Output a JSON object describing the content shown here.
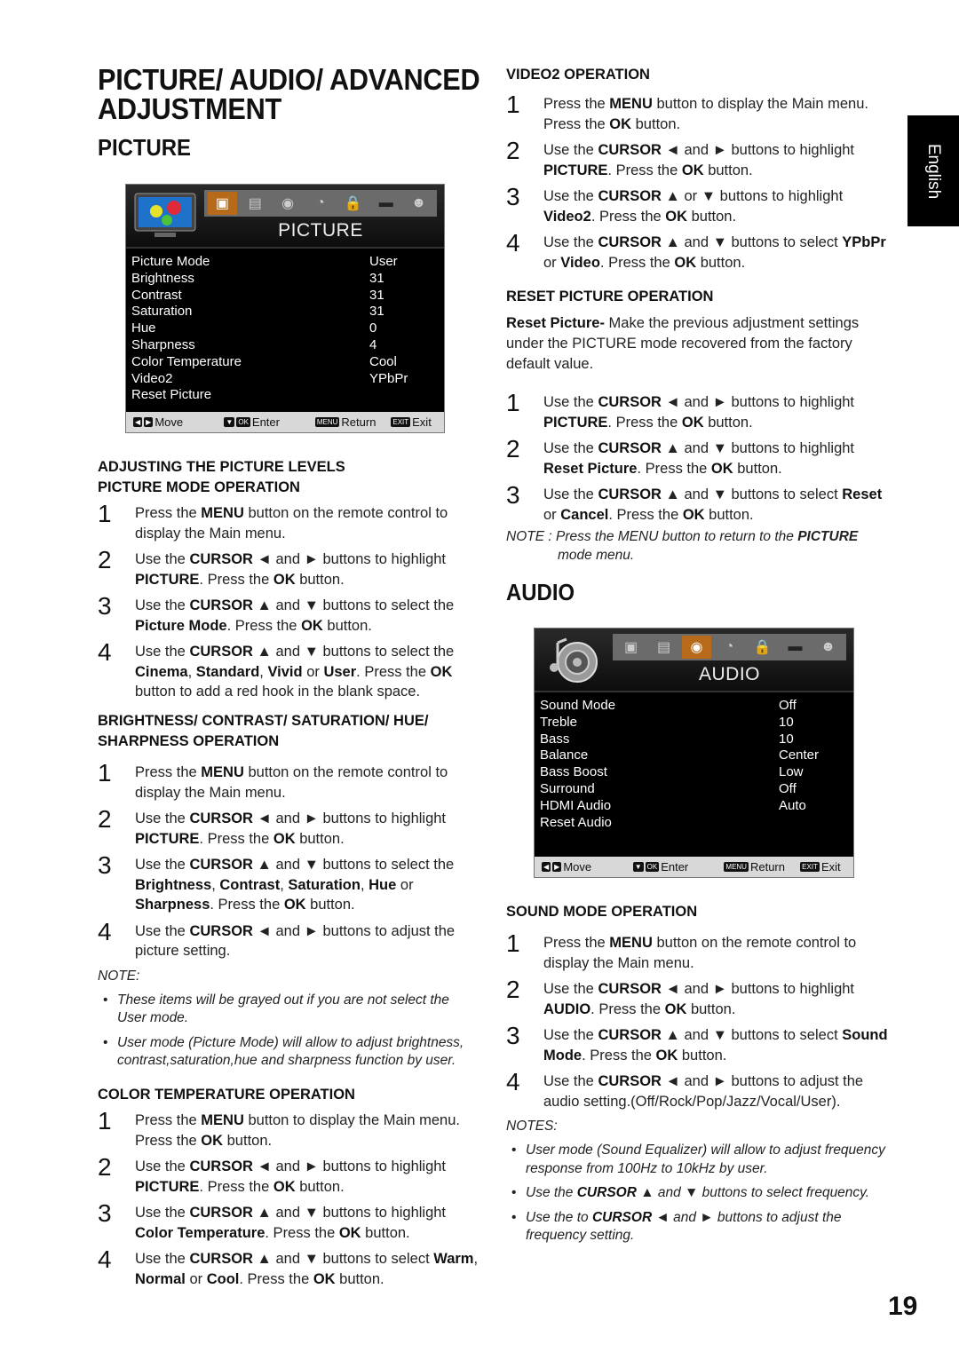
{
  "page": {
    "title_line1": "PICTURE/ AUDIO/ ADVANCED",
    "title_line2": "ADJUSTMENT",
    "language_tab": "English",
    "page_number": "19"
  },
  "picture": {
    "heading": "PICTURE",
    "osd": {
      "title": "PICTURE",
      "tabs": [
        "picture-icon",
        "screen-icon",
        "audio-icon",
        "time-icon",
        "lock-icon",
        "setup-icon",
        "parental-icon"
      ],
      "active_tab": 0,
      "rows": [
        {
          "label": "Picture Mode",
          "value": "User"
        },
        {
          "label": "Brightness",
          "value": "31"
        },
        {
          "label": "Contrast",
          "value": "31"
        },
        {
          "label": "Saturation",
          "value": "31"
        },
        {
          "label": "Hue",
          "value": "0"
        },
        {
          "label": "Sharpness",
          "value": "4"
        },
        {
          "label": "Color Temperature",
          "value": "Cool"
        },
        {
          "label": "Video2",
          "value": "YPbPr"
        },
        {
          "label": "Reset Picture",
          "value": ""
        }
      ],
      "footer": {
        "move": "Move",
        "enter": "Enter",
        "return": "Return",
        "exit": "Exit",
        "ok_key": "OK",
        "menu_key": "MENU",
        "exit_key": "EXIT"
      }
    },
    "section_adjusting": "ADJUSTING THE PICTURE LEVELS",
    "section_mode": "PICTURE MODE OPERATION",
    "mode_steps": [
      "1",
      "Press the <b>MENU</b> button on the remote control to display the Main menu.",
      "2",
      "Use the <b>CURSOR</b> ◄ and ► buttons to highlight <b>PICTURE</b>. Press the <b>OK</b> button.",
      "3",
      "Use the <b>CURSOR</b> ▲ and ▼ buttons to select the <b>Picture Mode</b>. Press the <b>OK</b> button.",
      "4",
      "Use the <b>CURSOR</b> ▲ and ▼ buttons to select the <b>Cinema</b>, <b>Standard</b>, <b>Vivid</b> or <b>User</b>. Press the <b>OK</b> button to add a red hook in the blank space."
    ],
    "section_bcsh": "BRIGHTNESS/ CONTRAST/ SATURATION/ HUE/ SHARPNESS OPERATION",
    "bcsh_steps": [
      "1",
      "Press the <b>MENU</b> button on the remote control to display the Main menu.",
      "2",
      "Use the <b>CURSOR</b> ◄ and ► buttons to highlight <b>PICTURE</b>. Press the <b>OK</b> button.",
      "3",
      "Use the <b>CURSOR</b> ▲ and ▼ buttons to select the <b>Brightness</b>, <b>Contrast</b>, <b>Saturation</b>, <b>Hue</b> or <b>Sharpness</b>. Press the <b>OK</b> button.",
      "4",
      "Use the <b>CURSOR</b> ◄ and ► buttons to adjust the picture setting."
    ],
    "note_title": "NOTE:",
    "notes": [
      "These items will be grayed out if you are not select the User mode.",
      "User mode (Picture Mode) will allow to adjust brightness, contrast,saturation,hue and sharpness function by user."
    ],
    "section_color": "COLOR TEMPERATURE OPERATION",
    "color_steps": [
      "1",
      "Press the <b>MENU</b> button to display the Main menu. Press the <b>OK</b> button.",
      "2",
      "Use the <b>CURSOR</b> ◄ and ► buttons to highlight <b>PICTURE</b>. Press the <b>OK</b> button.",
      "3",
      "Use the <b>CURSOR</b> ▲ and ▼ buttons to highlight <b>Color Temperature</b>. Press the <b>OK</b> button.",
      "4",
      "Use the <b>CURSOR</b> ▲ and ▼ buttons to select <b>Warm</b>, <b>Normal</b> or <b>Cool</b>. Press the <b>OK</b> button."
    ],
    "section_video2": "VIDEO2 OPERATION",
    "video2_steps": [
      "1",
      "Press the <b>MENU</b> button to display the Main menu. Press the <b>OK</b> button.",
      "2",
      "Use the <b>CURSOR</b> ◄ and ► buttons to highlight <b>PICTURE</b>. Press the <b>OK</b> button.",
      "3",
      "Use the <b>CURSOR</b> ▲ or ▼ buttons to highlight <b>Video2</b>. Press the <b>OK</b> button.",
      "4",
      "Use the <b>CURSOR</b> ▲ and ▼ buttons to select <b>YPbPr</b> or <b>Video</b>. Press the <b>OK</b> button."
    ],
    "section_reset": "RESET PICTURE OPERATION",
    "reset_intro": "<b>Reset Picture-</b> Make the previous adjustment settings under the PICTURE mode recovered from the factory default value.",
    "reset_steps": [
      "1",
      "Use the <b>CURSOR</b> ◄ and ► buttons to highlight <b>PICTURE</b>. Press the <b>OK</b> button.",
      "2",
      "Use the <b>CURSOR</b> ▲ and ▼ buttons to highlight <b>Reset Picture</b>. Press the <b>OK</b> button.",
      "3",
      "Use the <b>CURSOR</b> ▲ and ▼ buttons to select <b>Reset</b> or <b>Cancel</b>. Press the <b>OK</b> button."
    ],
    "reset_note": "NOTE : Press the MENU button to return to the <b>PICTURE</b><br><span style=\"padding-left:58px\">mode menu.</span>"
  },
  "audio": {
    "heading": "AUDIO",
    "osd": {
      "title": "AUDIO",
      "tabs": [
        "picture-icon",
        "screen-icon",
        "audio-icon",
        "time-icon",
        "lock-icon",
        "setup-icon",
        "parental-icon"
      ],
      "active_tab": 2,
      "rows": [
        {
          "label": "Sound Mode",
          "value": "Off"
        },
        {
          "label": "Treble",
          "value": "10"
        },
        {
          "label": "Bass",
          "value": "10"
        },
        {
          "label": "Balance",
          "value": "Center"
        },
        {
          "label": "Bass Boost",
          "value": "Low"
        },
        {
          "label": "Surround",
          "value": "Off"
        },
        {
          "label": "HDMI Audio",
          "value": "Auto"
        },
        {
          "label": "Reset Audio",
          "value": ""
        }
      ],
      "footer": {
        "move": "Move",
        "enter": "Enter",
        "return": "Return",
        "exit": "Exit",
        "ok_key": "OK",
        "menu_key": "MENU",
        "exit_key": "EXIT"
      }
    },
    "section_sound": "SOUND MODE OPERATION",
    "sound_steps": [
      "1",
      "Press the <b>MENU</b> button on the remote control to display the Main menu.",
      "2",
      "Use the <b>CURSOR</b> ◄ and ► buttons to highlight <b>AUDIO</b>. Press the <b>OK</b> button.",
      "3",
      "Use the <b>CURSOR</b> ▲ and ▼ buttons to select <b>Sound Mode</b>. Press the <b>OK</b> button.",
      "4",
      "Use the <b>CURSOR</b> ◄ and ► buttons to adjust the audio setting.(Off/Rock/Pop/Jazz/Vocal/User)."
    ],
    "notes_title": "NOTES:",
    "notes": [
      "User mode (Sound Equalizer) will allow to adjust frequency response from 100Hz to 10kHz by user.",
      "Use the <b>CURSOR</b> ▲ and ▼ buttons to select frequency.",
      "Use the to <b>CURSOR</b> ◄ and ► buttons to adjust the frequency setting."
    ]
  }
}
